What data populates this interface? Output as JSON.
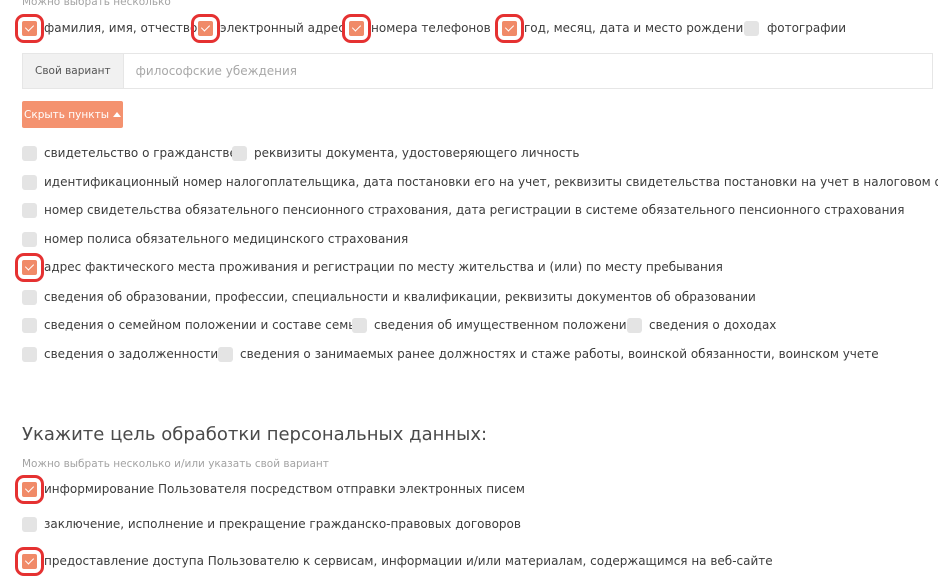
{
  "personal_data": {
    "hint": "Можно выбрать несколько",
    "top_options": [
      {
        "label": "фамилия, имя, отчество",
        "checked": true
      },
      {
        "label": "электронный адрес",
        "checked": true
      },
      {
        "label": "номера телефонов",
        "checked": true
      },
      {
        "label": "год, месяц, дата и место рождения",
        "checked": true
      },
      {
        "label": "фотографии",
        "checked": false
      }
    ],
    "own_variant": {
      "tag": "Свой вариант",
      "placeholder": "философские убеждения"
    },
    "toggle_label": "Скрыть пункты",
    "extra_options": [
      {
        "label": "свидетельство о гражданстве",
        "checked": false
      },
      {
        "label": "реквизиты документа, удостоверяющего личность",
        "checked": false
      },
      {
        "label": "идентификационный номер налогоплательщика, дата постановки его на учет, реквизиты свидетельства постановки на учет в налоговом органе",
        "checked": false
      },
      {
        "label": "номер свидетельства обязательного пенсионного страхования, дата регистрации в системе обязательного пенсионного страхования",
        "checked": false
      },
      {
        "label": "номер полиса обязательного медицинского страхования",
        "checked": false
      },
      {
        "label": "адрес фактического места проживания и регистрации по месту жительства и (или) по месту пребывания",
        "checked": true
      },
      {
        "label": "сведения об образовании, профессии, специальности и квалификации, реквизиты документов об образовании",
        "checked": false
      },
      {
        "label": "сведения о семейном положении и составе семьи",
        "checked": false
      },
      {
        "label": "сведения об имущественном положении",
        "checked": false
      },
      {
        "label": "сведения о доходах",
        "checked": false
      },
      {
        "label": "сведения о задолженности",
        "checked": false
      },
      {
        "label": "сведения о занимаемых ранее должностях и стаже работы, воинской обязанности, воинском учете",
        "checked": false
      }
    ]
  },
  "purpose": {
    "title": "Укажите цель обработки персональных данных:",
    "hint": "Можно выбрать несколько и/или указать свой вариант",
    "options": [
      {
        "label": "информирование Пользователя посредством отправки электронных писем",
        "checked": true
      },
      {
        "label": "заключение, исполнение и прекращение гражданско-правовых договоров",
        "checked": false
      },
      {
        "label": "предоставление доступа Пользователю к сервисам, информации и/или материалам, содержащимся на веб-сайте",
        "checked": true
      }
    ]
  },
  "colors": {
    "accent": "#f4926f",
    "checkbox_on": "#f08a68",
    "checkbox_off": "#e4e4e4",
    "highlight": "#e53131"
  }
}
